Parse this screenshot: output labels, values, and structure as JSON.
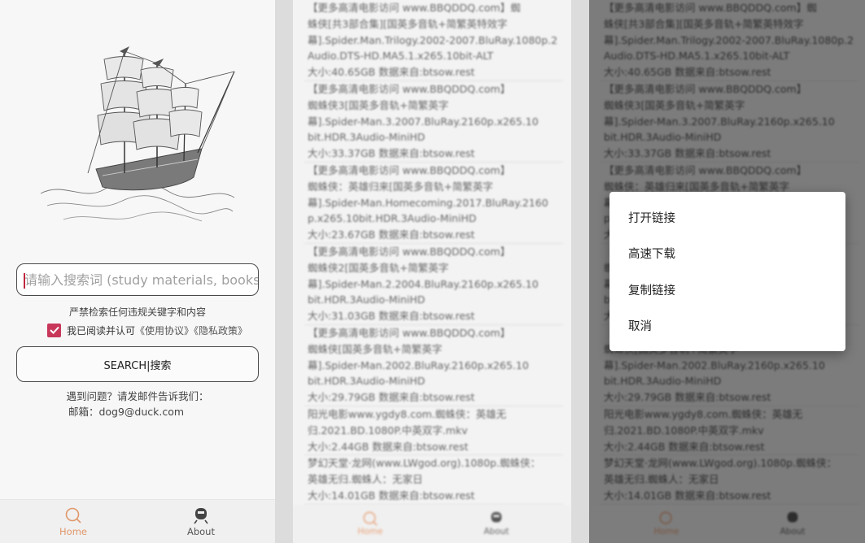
{
  "home": {
    "search_placeholder": "请输入搜索词 (study materials, books, ",
    "warning": "严禁检索任何违规关键字和内容",
    "agree_prefix": "我已阅读并认可",
    "agree_links": "《使用协议》《隐私政策》",
    "agree_checked": true,
    "search_button": "SEARCH|搜索",
    "help_line1": "遇到问题？请发邮件告诉我们：",
    "help_line2": "邮箱：dog9@duck.com",
    "nav": {
      "home": "Home",
      "about": "About"
    },
    "accent_color": "#c8375a",
    "nav_active_color": "#e0976a"
  },
  "results": [
    {
      "lines": [
        "【更多高清电影访问 www.BBQDDQ.com】蜘",
        "蛛侠[共3部合集][国英多音轨+简繁英特效字",
        "幕].Spider.Man.Trilogy.2002-2007.BluRay.1080p.2",
        "Audio.DTS-HD.MA5.1.x265.10bit-ALT",
        "大小:40.65GB 数据来自:btsow.rest"
      ]
    },
    {
      "lines": [
        "【更多高清电影访问 www.BBQDDQ.com】",
        "蜘蛛侠3[国英多音轨+简繁英字",
        "幕].Spider-Man.3.2007.BluRay.2160p.x265.10",
        "bit.HDR.3Audio-MiniHD",
        "大小:33.37GB 数据来自:btsow.rest"
      ]
    },
    {
      "lines": [
        "【更多高清电影访问 www.BBQDDQ.com】",
        "蜘蛛侠：英雄归来[国英多音轨+简繁英字",
        "幕].Spider-Man.Homecoming.2017.BluRay.2160",
        "p.x265.10bit.HDR.3Audio-MiniHD",
        "大小:23.67GB 数据来自:btsow.rest"
      ]
    },
    {
      "lines": [
        "【更多高清电影访问 www.BBQDDQ.com】",
        "蜘蛛侠2[国英多音轨+简繁英字",
        "幕].Spider-Man.2.2004.BluRay.2160p.x265.10",
        "bit.HDR.3Audio-MiniHD",
        "大小:31.03GB 数据来自:btsow.rest"
      ]
    },
    {
      "lines": [
        "【更多高清电影访问 www.BBQDDQ.com】",
        "蜘蛛侠[国英多音轨+简繁英字",
        "幕].Spider-Man.2002.BluRay.2160p.x265.10",
        "bit.HDR.3Audio-MiniHD",
        "大小:29.79GB 数据来自:btsow.rest"
      ]
    },
    {
      "lines": [
        "阳光电影www.ygdy8.com.蜘蛛侠：英雄无",
        "归.2021.BD.1080P.中英双字.mkv",
        "大小:2.44GB 数据来自:btsow.rest"
      ]
    },
    {
      "lines": [
        "梦幻天堂·龙网(www.LWgod.org).1080p.蜘蛛侠：",
        "英雄无归.蜘蛛人：无家日",
        "大小:14.01GB 数据来自:btsow.rest"
      ]
    }
  ],
  "context_menu": {
    "items": [
      "打开链接",
      "高速下载",
      "复制链接",
      "取消"
    ]
  }
}
